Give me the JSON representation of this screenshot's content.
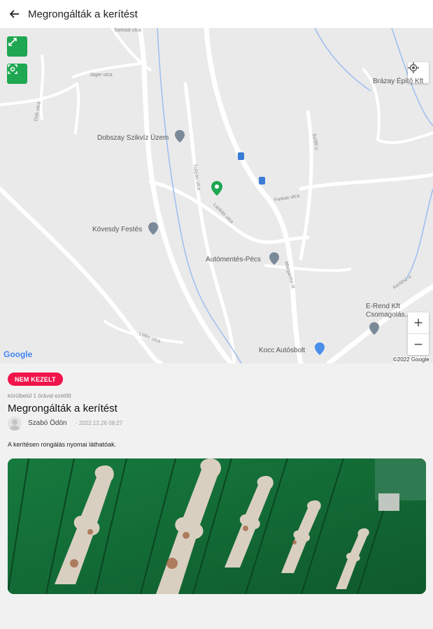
{
  "header": {
    "title": "Megrongálták a kerítést",
    "back_icon": "arrow-left-icon"
  },
  "map": {
    "google_logo": "Google",
    "copyright": "©2022 Google",
    "zoom_in": "+",
    "zoom_out": "−",
    "pois": [
      "Dobszay Szikvíz Üzem",
      "Kövesdy Festés",
      "Autómentés-Pécs",
      "Brázay Építő Kft",
      "E-Rend Kft Csomagolás...",
      "Kocc Autósbolt"
    ],
    "streets": [
      "Sarkadi utca",
      "Jáger utca",
      "Dob utca",
      "Szőlő u.",
      "Tulipán utca",
      "Lankás utca",
      "Farkas utca",
      "Margaréta út",
      "Littke utca",
      "Kertész u."
    ]
  },
  "report": {
    "status": "NEM KEZELT",
    "submitted": "körülbelül 1 órával ezelőtt",
    "title": "Megrongálták a kerítést",
    "author": "Szabó Ödön",
    "date": "· 2022.12.26 08:27",
    "description": "A kerítésen rongálás nyomai láthatóak."
  },
  "colors": {
    "accent": "#1fa752",
    "badge": "#f0144a",
    "marker": "#1fa752"
  }
}
